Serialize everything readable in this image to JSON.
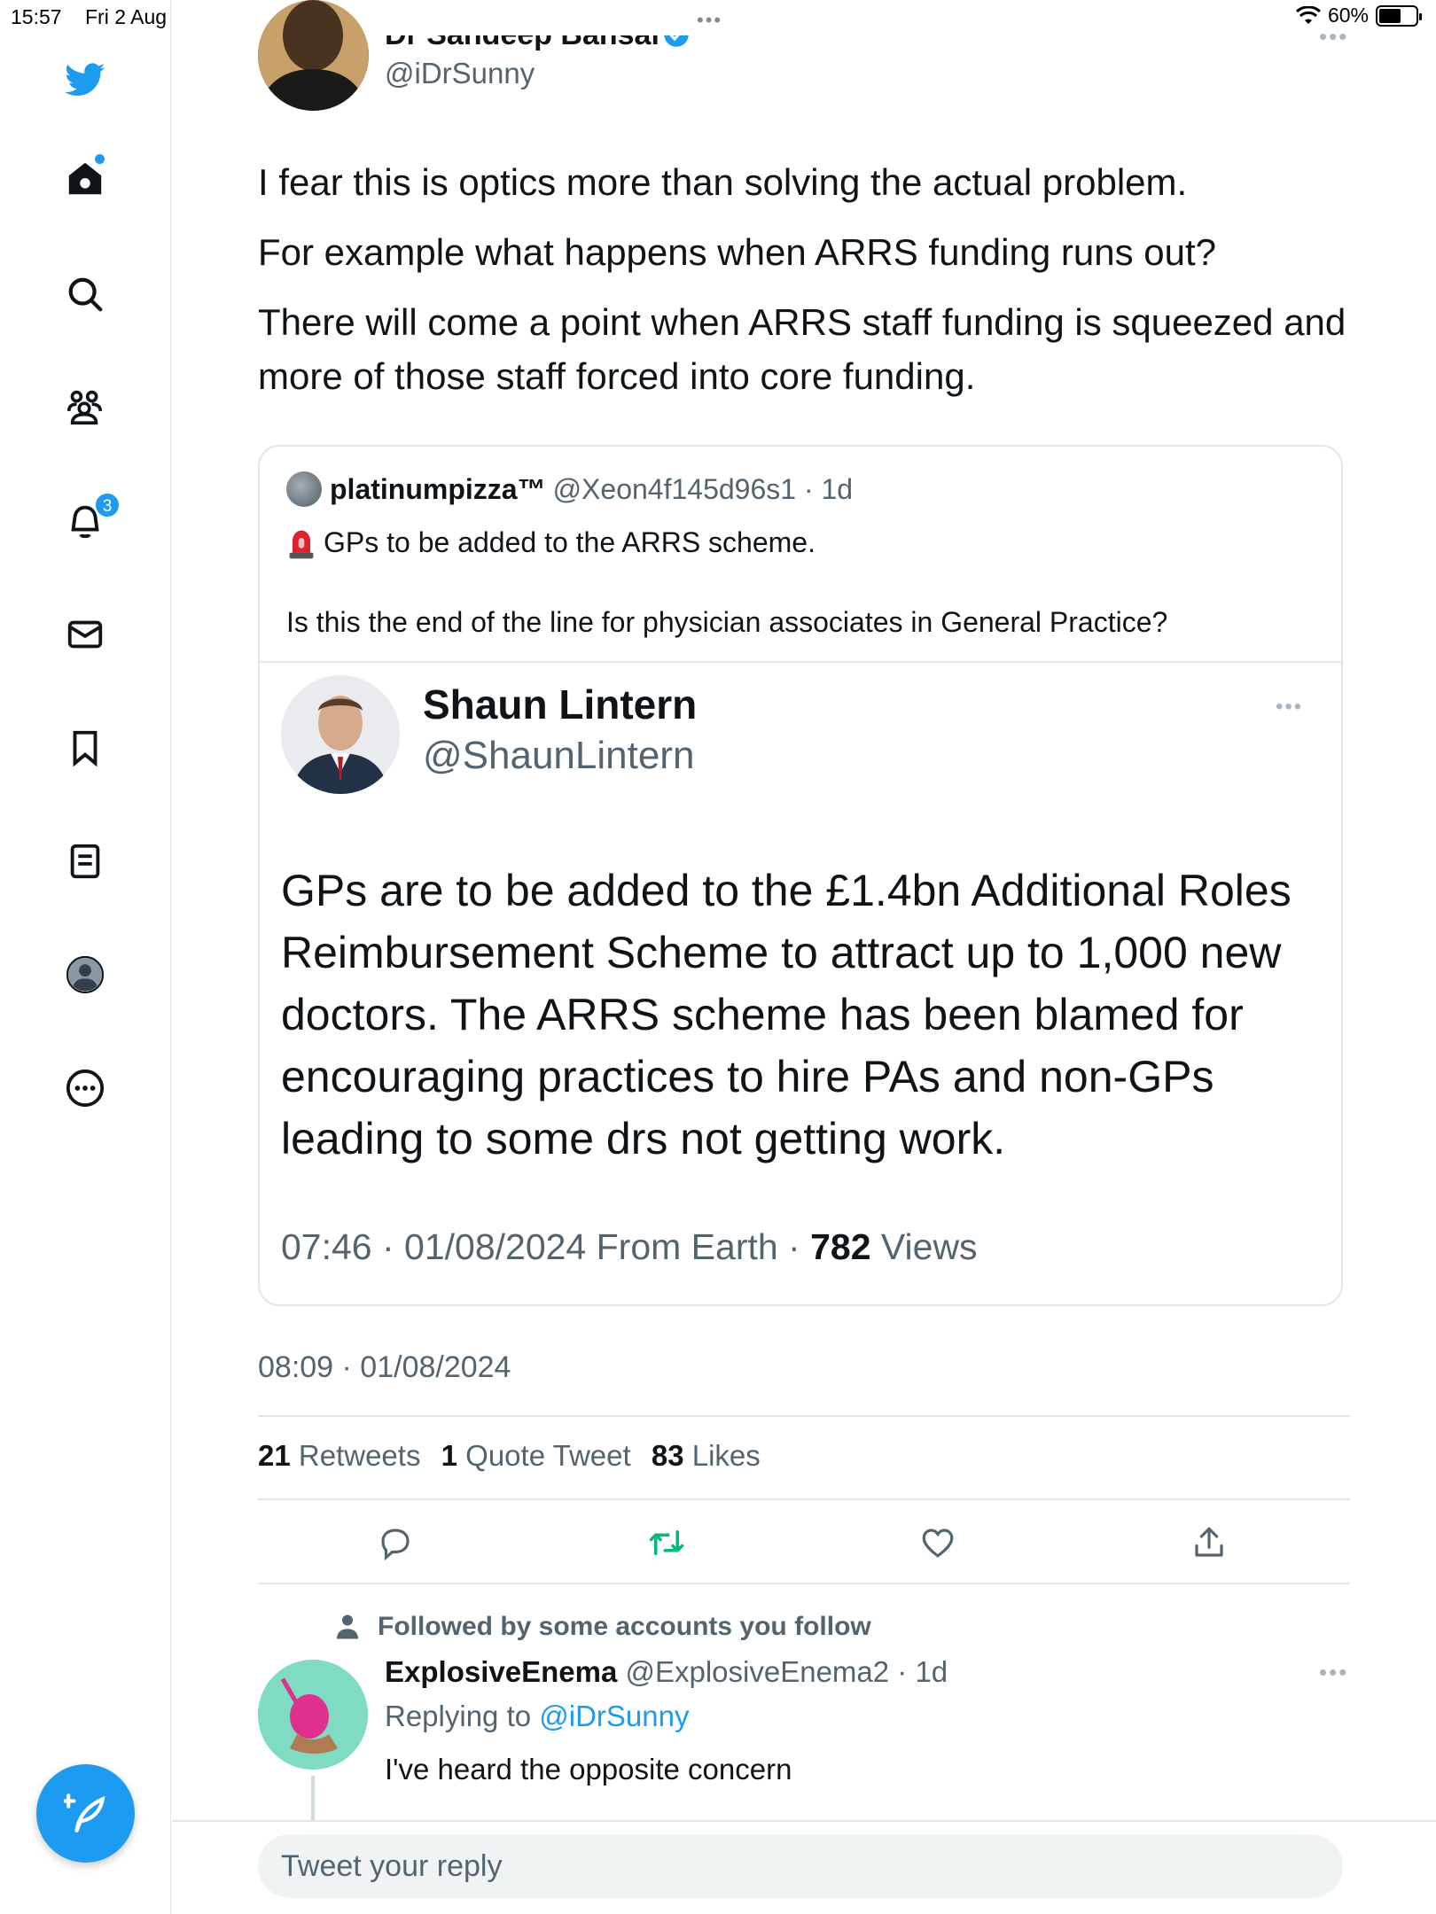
{
  "status_bar": {
    "time": "15:57",
    "date": "Fri 2 Aug",
    "dots": "•••",
    "battery": "60%"
  },
  "sidebar": {
    "items": [
      {
        "name": "home",
        "icon": "home-icon"
      },
      {
        "name": "explore",
        "icon": "search-icon"
      },
      {
        "name": "communities",
        "icon": "people-icon"
      },
      {
        "name": "notifications",
        "icon": "bell-icon",
        "badge": "3"
      },
      {
        "name": "messages",
        "icon": "mail-icon"
      },
      {
        "name": "bookmarks",
        "icon": "bookmark-icon"
      },
      {
        "name": "lists",
        "icon": "list-icon"
      },
      {
        "name": "profile",
        "icon": "avatar-icon"
      },
      {
        "name": "more",
        "icon": "more-circle-icon"
      }
    ],
    "compose_icon": "feather-plus-icon"
  },
  "tweet": {
    "author_name": "Dr Sandeep Bansal",
    "author_handle": "@iDrSunny",
    "more": "•••",
    "paragraphs": [
      "I fear this is optics more than solving the actual problem.",
      "For example what happens when ARRS funding runs out?",
      "There will come a point when ARRS staff funding is squeezed and more of those staff forced into core funding."
    ],
    "quote": {
      "name": "platinumpizza™",
      "meta": "@Xeon4f145d96s1 · 1d",
      "line1": "GPs to be added to the ARRS scheme.",
      "line2": "Is this the end of the line for physician associates in General Practice?",
      "screenshot": {
        "name": "Shaun Lintern",
        "handle": "@ShaunLintern",
        "more": "•••",
        "text": "GPs are to be added to the £1.4bn Additional Roles Reimbursement Scheme to attract up to 1,000 new doctors. The ARRS scheme has been blamed for encouraging practices to hire PAs and non-GPs leading to some drs not getting work.",
        "footer_time": "07:46 · 01/08/2024 From Earth · ",
        "footer_views_count": "782",
        "footer_views_label": " Views"
      }
    },
    "timestamp": "08:09 · 01/08/2024",
    "stats": {
      "retweets_count": "21",
      "retweets_label": " Retweets",
      "quotes_count": "1",
      "quotes_label": " Quote Tweet",
      "likes_count": "83",
      "likes_label": " Likes"
    },
    "actions": [
      "reply-icon",
      "retweet-icon",
      "like-icon",
      "share-icon"
    ],
    "colors": {
      "accent": "#1d9bf0",
      "retweet_active": "#00ba7c",
      "secondary_text": "#536471"
    }
  },
  "reply": {
    "followed_note": "Followed by some accounts you follow",
    "name": "ExplosiveEnema",
    "meta": "@ExplosiveEnema2 · 1d",
    "more": "•••",
    "replying_prefix": "Replying to ",
    "replying_mention": "@iDrSunny",
    "text": "I've heard the opposite concern"
  },
  "reply_bar": {
    "placeholder": "Tweet your reply"
  }
}
